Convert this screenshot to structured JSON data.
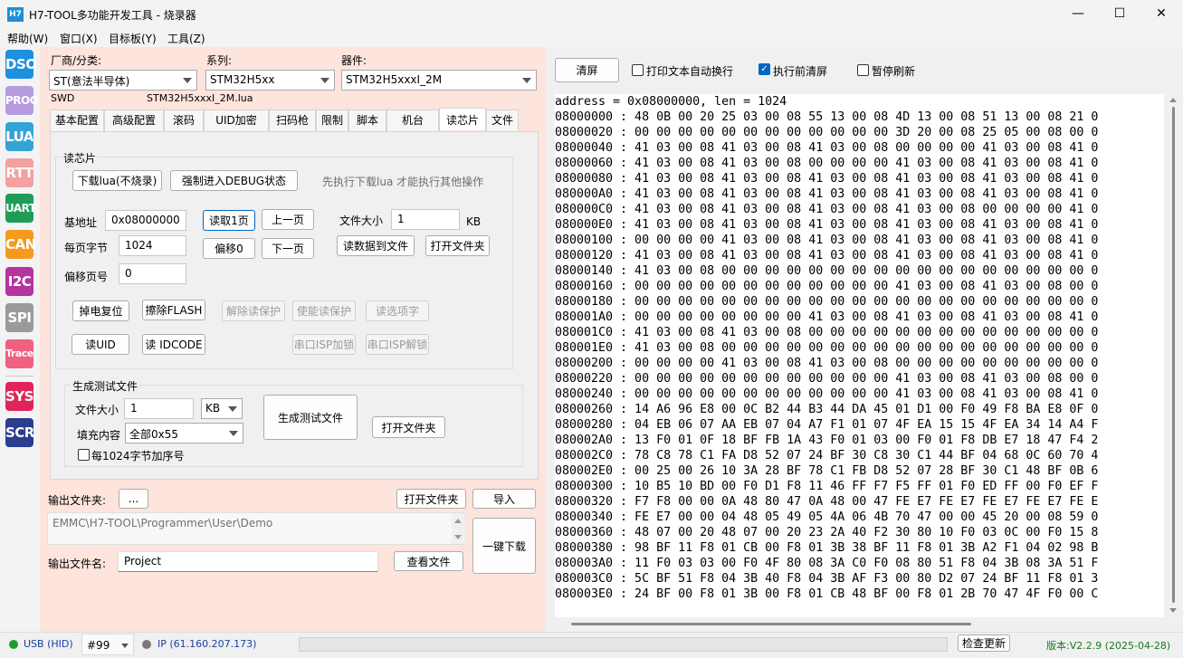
{
  "window": {
    "icon_text": "H7",
    "title": "H7-TOOL多功能开发工具 - 烧录器",
    "minimize_glyph": "—",
    "maximize_glyph": "☐",
    "close_glyph": "✕"
  },
  "menu": [
    "帮助(W)",
    "窗口(X)",
    "目标板(Y)",
    "工具(Z)"
  ],
  "sidebar": [
    {
      "label": "DSO",
      "color": "#1e90e0"
    },
    {
      "label": "PROG",
      "color": "#b79be0"
    },
    {
      "label": "LUA",
      "color": "#34a3d6"
    },
    {
      "label": "RTT",
      "color": "#f2a0a0"
    },
    {
      "label": "UART",
      "color": "#1f9c57"
    },
    {
      "label": "CAN",
      "color": "#f59a1e"
    },
    {
      "label": "I2C",
      "color": "#b5349f"
    },
    {
      "label": "SPI",
      "color": "#9a9a9a"
    },
    {
      "label": "Trace",
      "color": "#f06080"
    },
    {
      "label": "SYS",
      "color": "#e0245a"
    },
    {
      "label": "SCR",
      "color": "#2a3e8f"
    }
  ],
  "selectors": {
    "vendor_label": "厂商/分类:",
    "vendor_value": "ST(意法半导体)",
    "series_label": "系列:",
    "series_value": "STM32H5xx",
    "device_label": "器件:",
    "device_value": "STM32H5xxxI_2M",
    "interface": "SWD",
    "lua_file": "STM32H5xxxI_2M.lua"
  },
  "tabs": [
    "基本配置",
    "高级配置",
    "滚码",
    "UID加密",
    "扫码枪",
    "限制",
    "脚本",
    "机台",
    "读芯片",
    "文件"
  ],
  "read_chip": {
    "group_title": "读芯片",
    "download_lua_btn": "下载lua(不烧录)",
    "force_debug_btn": "强制进入DEBUG状态",
    "hint": "先执行下载lua 才能执行其他操作",
    "base_addr_label": "基地址",
    "base_addr_value": "0x08000000",
    "read_page_btn": "读取1页",
    "prev_page_btn": "上一页",
    "file_size_label": "文件大小",
    "file_size_value": "1",
    "file_size_unit": "KB",
    "page_bytes_label": "每页字节",
    "page_bytes_value": "1024",
    "offset_zero_btn": "偏移0",
    "next_page_btn": "下一页",
    "read_to_file_btn": "读数据到文件",
    "open_folder_btn": "打开文件夹",
    "offset_page_label": "偏移页号",
    "offset_page_value": "0",
    "power_reset_btn": "掉电复位",
    "erase_flash_btn": "擦除FLASH",
    "unprotect_btn": "解除读保护",
    "protect_btn": "使能读保护",
    "read_option_btn": "读选项字",
    "read_uid_btn": "读UID",
    "read_idcode_btn": "读 IDCODE",
    "isp_lock_btn": "串口ISP加锁",
    "isp_unlock_btn": "串口ISP解锁"
  },
  "gen_test": {
    "group_title": "生成测试文件",
    "size_label": "文件大小",
    "size_value": "1",
    "unit_value": "KB",
    "fill_label": "填充内容",
    "fill_value": "全部0x55",
    "seq_checkbox_label": "每1024字节加序号",
    "gen_btn": "生成测试文件",
    "open_folder_btn": "打开文件夹"
  },
  "output": {
    "folder_label": "输出文件夹:",
    "browse_btn": "...",
    "open_folder_btn": "打开文件夹",
    "import_btn": "导入",
    "folder_path": "EMMC\\H7-TOOL\\Programmer\\User\\Demo",
    "filename_label": "输出文件名:",
    "filename_value": "Project",
    "view_file_btn": "查看文件",
    "one_key_btn": "一键下载"
  },
  "log_toolbar": {
    "clear_btn": "清屏",
    "wrap_label": "打印文本自动换行",
    "wrap_checked": false,
    "clear_before_label": "执行前清屏",
    "clear_before_checked": true,
    "pause_label": "暂停刷新",
    "pause_checked": false
  },
  "log_lines": [
    "address = 0x08000000, len = 1024",
    "08000000 : 48 0B 00 20 25 03 00 08 55 13 00 08 4D 13 00 08 51 13 00 08 21 0",
    "08000020 : 00 00 00 00 00 00 00 00 00 00 00 00 3D 20 00 08 25 05 00 08 00 0",
    "08000040 : 41 03 00 08 41 03 00 08 41 03 00 08 00 00 00 00 41 03 00 08 41 0",
    "08000060 : 41 03 00 08 41 03 00 08 00 00 00 00 41 03 00 08 41 03 00 08 41 0",
    "08000080 : 41 03 00 08 41 03 00 08 41 03 00 08 41 03 00 08 41 03 00 08 41 0",
    "080000A0 : 41 03 00 08 41 03 00 08 41 03 00 08 41 03 00 08 41 03 00 08 41 0",
    "080000C0 : 41 03 00 08 41 03 00 08 41 03 00 08 41 03 00 08 00 00 00 00 41 0",
    "080000E0 : 41 03 00 08 41 03 00 08 41 03 00 08 41 03 00 08 41 03 00 08 41 0",
    "08000100 : 00 00 00 00 41 03 00 08 41 03 00 08 41 03 00 08 41 03 00 08 41 0",
    "08000120 : 41 03 00 08 41 03 00 08 41 03 00 08 41 03 00 08 41 03 00 08 41 0",
    "08000140 : 41 03 00 08 00 00 00 00 00 00 00 00 00 00 00 00 00 00 00 00 00 0",
    "08000160 : 00 00 00 00 00 00 00 00 00 00 00 00 41 03 00 08 41 03 00 08 00 0",
    "08000180 : 00 00 00 00 00 00 00 00 00 00 00 00 00 00 00 00 00 00 00 00 00 0",
    "080001A0 : 00 00 00 00 00 00 00 00 41 03 00 08 41 03 00 08 41 03 00 08 41 0",
    "080001C0 : 41 03 00 08 41 03 00 08 00 00 00 00 00 00 00 00 00 00 00 00 00 0",
    "080001E0 : 41 03 00 08 00 00 00 00 00 00 00 00 00 00 00 00 00 00 00 00 00 0",
    "08000200 : 00 00 00 00 41 03 00 08 41 03 00 08 00 00 00 00 00 00 00 00 00 0",
    "08000220 : 00 00 00 00 00 00 00 00 00 00 00 00 41 03 00 08 41 03 00 08 00 0",
    "08000240 : 00 00 00 00 00 00 00 00 00 00 00 00 41 03 00 08 41 03 00 08 41 0",
    "08000260 : 14 A6 96 E8 00 0C B2 44 B3 44 DA 45 01 D1 00 F0 49 F8 BA E8 0F 0",
    "08000280 : 04 EB 06 07 AA EB 07 04 A7 F1 01 07 4F EA 15 15 4F EA 34 14 A4 F",
    "080002A0 : 13 F0 01 0F 18 BF FB 1A 43 F0 01 03 00 F0 01 F8 DB E7 18 47 F4 2",
    "080002C0 : 78 C8 78 C1 FA D8 52 07 24 BF 30 C8 30 C1 44 BF 04 68 0C 60 70 4",
    "080002E0 : 00 25 00 26 10 3A 28 BF 78 C1 FB D8 52 07 28 BF 30 C1 48 BF 0B 6",
    "08000300 : 10 B5 10 BD 00 F0 D1 F8 11 46 FF F7 F5 FF 01 F0 ED FF 00 F0 EF F",
    "08000320 : F7 F8 00 00 0A 48 80 47 0A 48 00 47 FE E7 FE E7 FE E7 FE E7 FE E",
    "08000340 : FE E7 00 00 04 48 05 49 05 4A 06 4B 70 47 00 00 45 20 00 08 59 0",
    "08000360 : 48 07 00 20 48 07 00 20 23 2A 40 F2 30 80 10 F0 03 0C 00 F0 15 8",
    "08000380 : 98 BF 11 F8 01 CB 00 F8 01 3B 38 BF 11 F8 01 3B A2 F1 04 02 98 B",
    "080003A0 : 11 F0 03 03 00 F0 4F 80 08 3A C0 F0 08 80 51 F8 04 3B 08 3A 51 F",
    "080003C0 : 5C BF 51 F8 04 3B 40 F8 04 3B AF F3 00 80 D2 07 24 BF 11 F8 01 3",
    "080003E0 : 24 BF 00 F8 01 3B 00 F8 01 CB 48 BF 00 F8 01 2B 70 47 4F F0 00 C"
  ],
  "status": {
    "usb_label": "USB (HID)",
    "usb_color": "#1a9f2c",
    "device_num": "#99",
    "ip_label": "IP (61.160.207.173)",
    "ip_color": "#7a7a7a",
    "check_update_btn": "检查更新",
    "version": "版本:V2.2.9 (2025-04-28)",
    "version_color": "#1a7a1a"
  }
}
